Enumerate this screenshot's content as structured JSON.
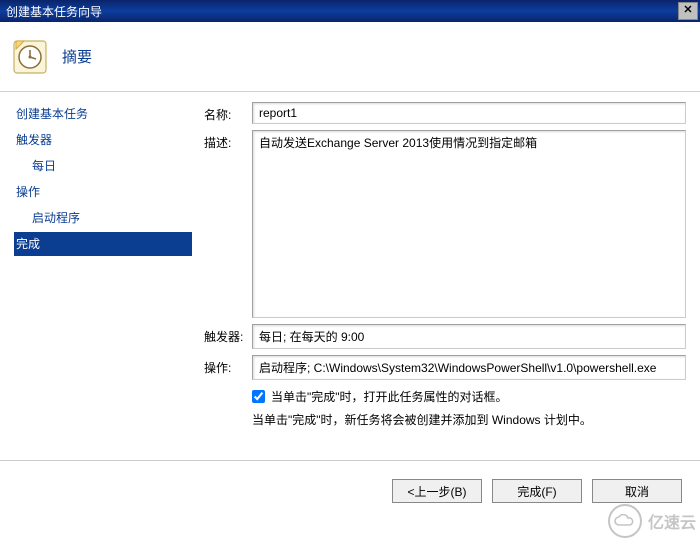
{
  "window": {
    "title": "创建基本任务向导"
  },
  "header": {
    "title": "摘要"
  },
  "sidebar": {
    "items": [
      {
        "label": "创建基本任务",
        "indent": 0
      },
      {
        "label": "触发器",
        "indent": 0
      },
      {
        "label": "每日",
        "indent": 1
      },
      {
        "label": "操作",
        "indent": 0
      },
      {
        "label": "启动程序",
        "indent": 1
      },
      {
        "label": "完成",
        "indent": 0,
        "selected": true
      }
    ]
  },
  "form": {
    "name_label": "名称:",
    "name_value": "report1",
    "desc_label": "描述:",
    "desc_value": "自动发送Exchange Server 2013使用情况到指定邮箱",
    "trigger_label": "触发器:",
    "trigger_value": "每日; 在每天的 9:00",
    "action_label": "操作:",
    "action_value": "启动程序; C:\\Windows\\System32\\WindowsPowerShell\\v1.0\\powershell.exe"
  },
  "checkbox": {
    "label": "当单击\"完成\"时，打开此任务属性的对话框。",
    "checked": true
  },
  "info_text": "当单击\"完成\"时，新任务将会被创建并添加到 Windows 计划中。",
  "buttons": {
    "back": "<上一步(B)",
    "finish": "完成(F)",
    "cancel": "取消"
  },
  "watermark": "亿速云"
}
